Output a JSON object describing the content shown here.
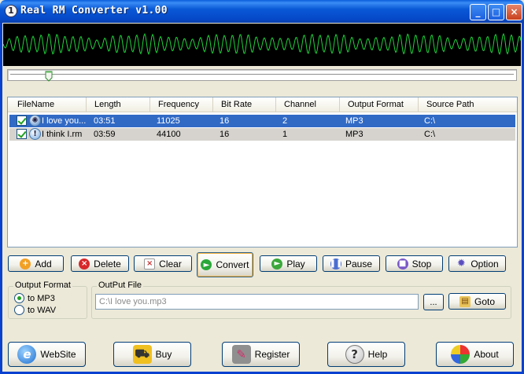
{
  "window": {
    "title": "Real RM Converter v1.00",
    "title_icon": "1",
    "controls": [
      "_",
      "□",
      "×"
    ]
  },
  "colors": {
    "waveform": "#1fd43a",
    "selection": "#316ac5"
  },
  "file_list": {
    "columns": [
      "FileName",
      "Length",
      "Frequency",
      "Bit Rate",
      "Channel",
      "Output Format",
      "Source Path"
    ],
    "rows": [
      {
        "checked": true,
        "selected": true,
        "icon": "audio-disc-icon",
        "filename": "I love you...",
        "length": "03:51",
        "frequency": "11025",
        "bit_rate": "16",
        "channel": "2",
        "output_format": "MP3",
        "source_path": "C:\\"
      },
      {
        "checked": true,
        "selected": false,
        "icon": "info-disc-icon",
        "filename": "I think I.rm",
        "length": "03:59",
        "frequency": "44100",
        "bit_rate": "16",
        "channel": "1",
        "output_format": "MP3",
        "source_path": "C:\\"
      }
    ]
  },
  "toolbar": {
    "add_label": "Add",
    "delete_label": "Delete",
    "clear_label": "Clear",
    "convert_label": "Convert",
    "play_label": "Play",
    "pause_label": "Pause",
    "stop_label": "Stop",
    "option_label": "Option"
  },
  "output_format": {
    "label": "Output Format",
    "options": [
      "to MP3",
      "to WAV"
    ],
    "selected": "to MP3"
  },
  "output_file": {
    "label": "OutPut File",
    "path": "C:\\I love you.mp3",
    "browse_label": "...",
    "goto_label": "Goto"
  },
  "footer": {
    "website_label": "WebSite",
    "buy_label": "Buy",
    "register_label": "Register",
    "help_label": "Help",
    "about_label": "About"
  },
  "playback": {
    "position_fraction": 0.07
  }
}
